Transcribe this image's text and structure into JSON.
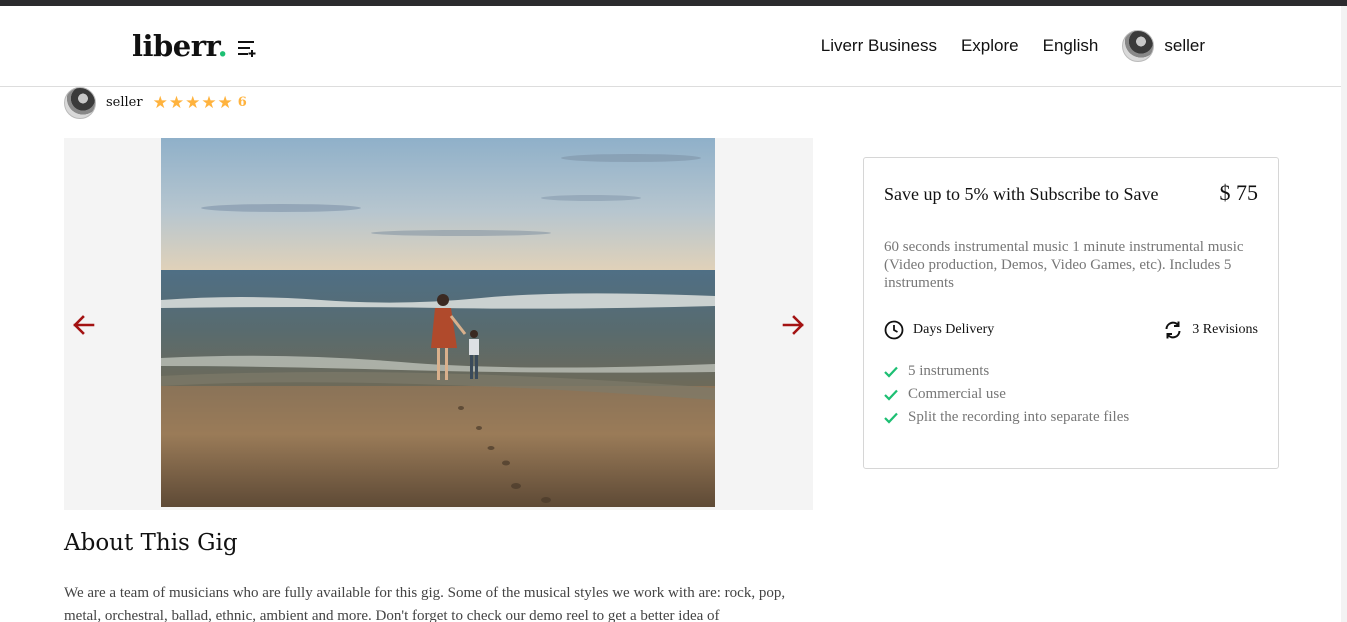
{
  "header": {
    "logo_text": "liberr",
    "logo_dot": ".",
    "nav": {
      "business": "Liverr Business",
      "explore": "Explore",
      "language": "English",
      "user": "seller"
    }
  },
  "seller": {
    "name": "seller",
    "stars": "★★★★★",
    "rating_count": "6"
  },
  "gallery": {
    "prev_icon": "arrow-left-icon",
    "next_icon": "arrow-right-icon",
    "image": "beach-photo"
  },
  "about": {
    "title": "About This Gig",
    "text": "We are a team of musicians who are fully available for this gig. Some of the musical styles we work with are: rock, pop, metal, orchestral, ballad, ethnic, ambient and more. Don't forget to check our demo reel to get a better idea of"
  },
  "package": {
    "title": "Save up to 5% with Subscribe to Save",
    "price": "$ 75",
    "description": "60 seconds instrumental music 1 minute instrumental music (Video production, Demos, Video Games, etc). Includes 5 instruments",
    "delivery": "Days Delivery",
    "revisions": "3 Revisions",
    "features": [
      "5 instruments",
      "Commercial use",
      "Split the recording into separate files"
    ]
  },
  "colors": {
    "accent_green": "#1dbf73",
    "star_yellow": "#ffb33e",
    "arrow_red": "#a31212"
  }
}
